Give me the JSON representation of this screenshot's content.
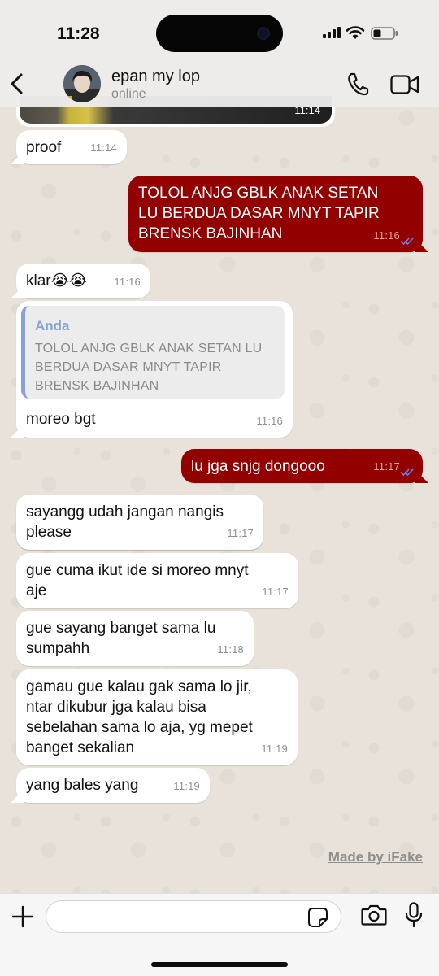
{
  "status_bar": {
    "time": "11:28"
  },
  "header": {
    "contact_name": "epan my lop",
    "contact_status": "online",
    "avatar_icon": "avatar-photo",
    "back_icon": "chevron-left-icon",
    "call_icon": "phone-icon",
    "video_icon": "video-camera-icon"
  },
  "messages": [
    {
      "direction": "in",
      "type": "image",
      "time": "11:14"
    },
    {
      "direction": "in",
      "text": "proof",
      "time": "11:14"
    },
    {
      "direction": "out",
      "text": "TOLOL ANJG GBLK ANAK SETAN\nLU BERDUA DASAR MNYT TAPIR\nBRENSK BAJINHAN",
      "time": "11:16",
      "read": true
    },
    {
      "direction": "in",
      "text": "klar😭😭",
      "time": "11:16"
    },
    {
      "direction": "in",
      "text": "moreo bgt",
      "time": "11:16",
      "quote": {
        "author": "Anda",
        "text": "TOLOL ANJG GBLK ANAK SETAN LU\nBERDUA DASAR MNYT TAPIR\nBRENSK BAJINHAN"
      }
    },
    {
      "direction": "out",
      "text": "lu jga snjg dongooo",
      "time": "11:17",
      "read": true
    },
    {
      "direction": "in",
      "text": "sayangg udah jangan nangis\nplease",
      "time": "11:17"
    },
    {
      "direction": "in",
      "text": "gue cuma ikut ide si moreo mnyt\naje",
      "time": "11:17"
    },
    {
      "direction": "in",
      "text": "gue sayang banget sama lu\nsumpahh",
      "time": "11:18"
    },
    {
      "direction": "in",
      "text": "gamau gue kalau gak sama lo jir,\nntar dikubur jga kalau bisa\nsebelahan sama lo aja, yg mepet\nbanget sekalian",
      "time": "11:19"
    },
    {
      "direction": "in",
      "text": "yang bales yang",
      "time": "11:19"
    }
  ],
  "watermark": "Made by iFake",
  "composer": {
    "placeholder": "",
    "plus_icon": "plus-icon",
    "sticker_icon": "sticker-icon",
    "camera_icon": "camera-icon",
    "mic_icon": "microphone-icon"
  },
  "colors": {
    "outgoing_bubble": "#920000",
    "incoming_bubble": "#ffffff",
    "read_ticks": "#6f7fd9",
    "quote_accent": "#8ba0d6"
  }
}
